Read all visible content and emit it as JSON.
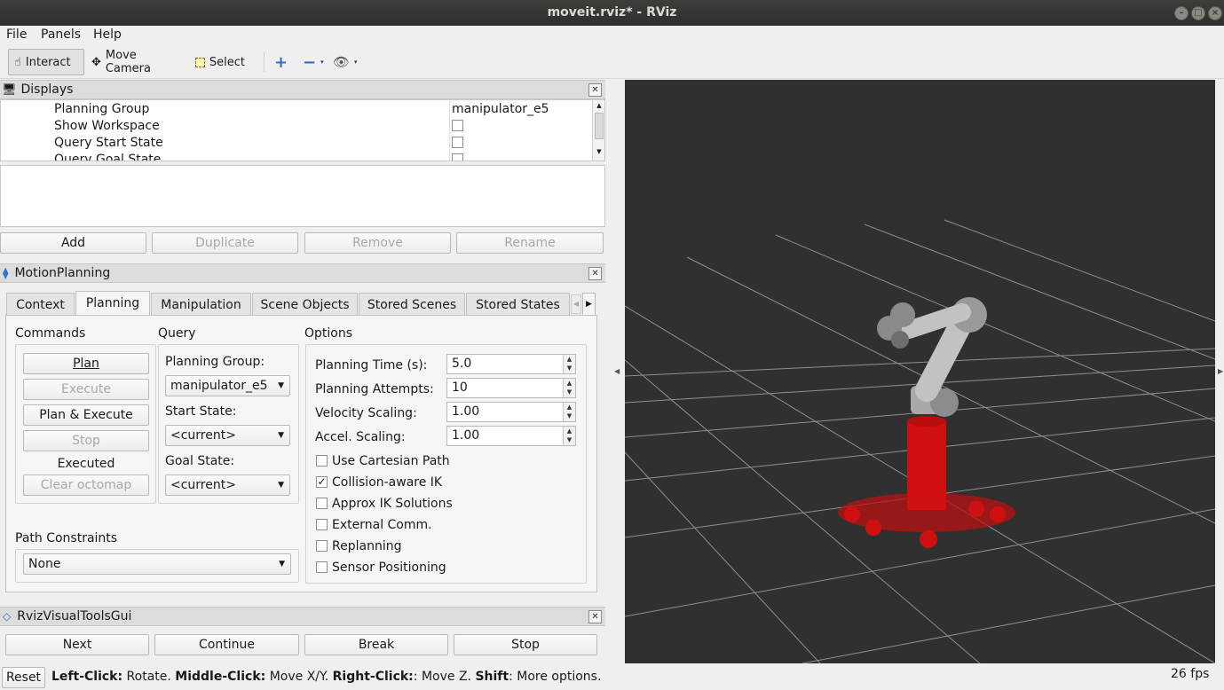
{
  "window": {
    "title": "moveit.rviz* - RViz"
  },
  "menu": [
    "File",
    "Panels",
    "Help"
  ],
  "toolbar": {
    "interact": "Interact",
    "move_camera": "Move Camera",
    "select": "Select"
  },
  "displays": {
    "title": "Displays",
    "rows": [
      {
        "name": "Planning Group",
        "value": "manipulator_e5"
      },
      {
        "name": "Show Workspace",
        "value": ""
      },
      {
        "name": "Query Start State",
        "value": ""
      },
      {
        "name": "Query Goal State",
        "value": ""
      }
    ],
    "buttons": {
      "add": "Add",
      "duplicate": "Duplicate",
      "remove": "Remove",
      "rename": "Rename"
    }
  },
  "motion_planning": {
    "title": "MotionPlanning",
    "tabs": [
      "Context",
      "Planning",
      "Manipulation",
      "Scene Objects",
      "Stored Scenes",
      "Stored States"
    ],
    "selected_tab": "Planning",
    "commands": {
      "heading": "Commands",
      "plan": "Plan",
      "execute": "Execute",
      "plan_execute": "Plan & Execute",
      "stop": "Stop",
      "status": "Executed",
      "clear_octomap": "Clear octomap"
    },
    "query": {
      "heading": "Query",
      "planning_group_label": "Planning Group:",
      "planning_group_value": "manipulator_e5",
      "start_state_label": "Start State:",
      "start_state_value": "<current>",
      "goal_state_label": "Goal State:",
      "goal_state_value": "<current>"
    },
    "options": {
      "heading": "Options",
      "planning_time_label": "Planning Time (s):",
      "planning_time": "5.0",
      "planning_attempts_label": "Planning Attempts:",
      "planning_attempts": "10",
      "velocity_scaling_label": "Velocity Scaling:",
      "velocity_scaling": "1.00",
      "accel_scaling_label": "Accel. Scaling:",
      "accel_scaling": "1.00",
      "checkboxes": [
        {
          "label": "Use Cartesian Path",
          "checked": false
        },
        {
          "label": "Collision-aware IK",
          "checked": true
        },
        {
          "label": "Approx IK Solutions",
          "checked": false
        },
        {
          "label": "External Comm.",
          "checked": false
        },
        {
          "label": "Replanning",
          "checked": false
        },
        {
          "label": "Sensor Positioning",
          "checked": false
        }
      ]
    },
    "path_constraints": {
      "label": "Path Constraints",
      "value": "None"
    }
  },
  "visual_tools": {
    "title": "RvizVisualToolsGui",
    "next": "Next",
    "continue": "Continue",
    "break": "Break",
    "stop": "Stop"
  },
  "statusbar": {
    "reset": "Reset",
    "hint_parts": [
      {
        "bold": "Left-Click:",
        "text": " Rotate. "
      },
      {
        "bold": "Middle-Click:",
        "text": " Move X/Y. "
      },
      {
        "bold": "Right-Click:",
        "text": ": Move Z. "
      },
      {
        "bold": "Shift",
        "text": ": More options."
      }
    ],
    "fps": "26 fps"
  },
  "viewport": {
    "background": "#303030",
    "grid": "#9a9a9a",
    "robot_base": "#d01010",
    "robot_arm": "#b8b8b8"
  }
}
